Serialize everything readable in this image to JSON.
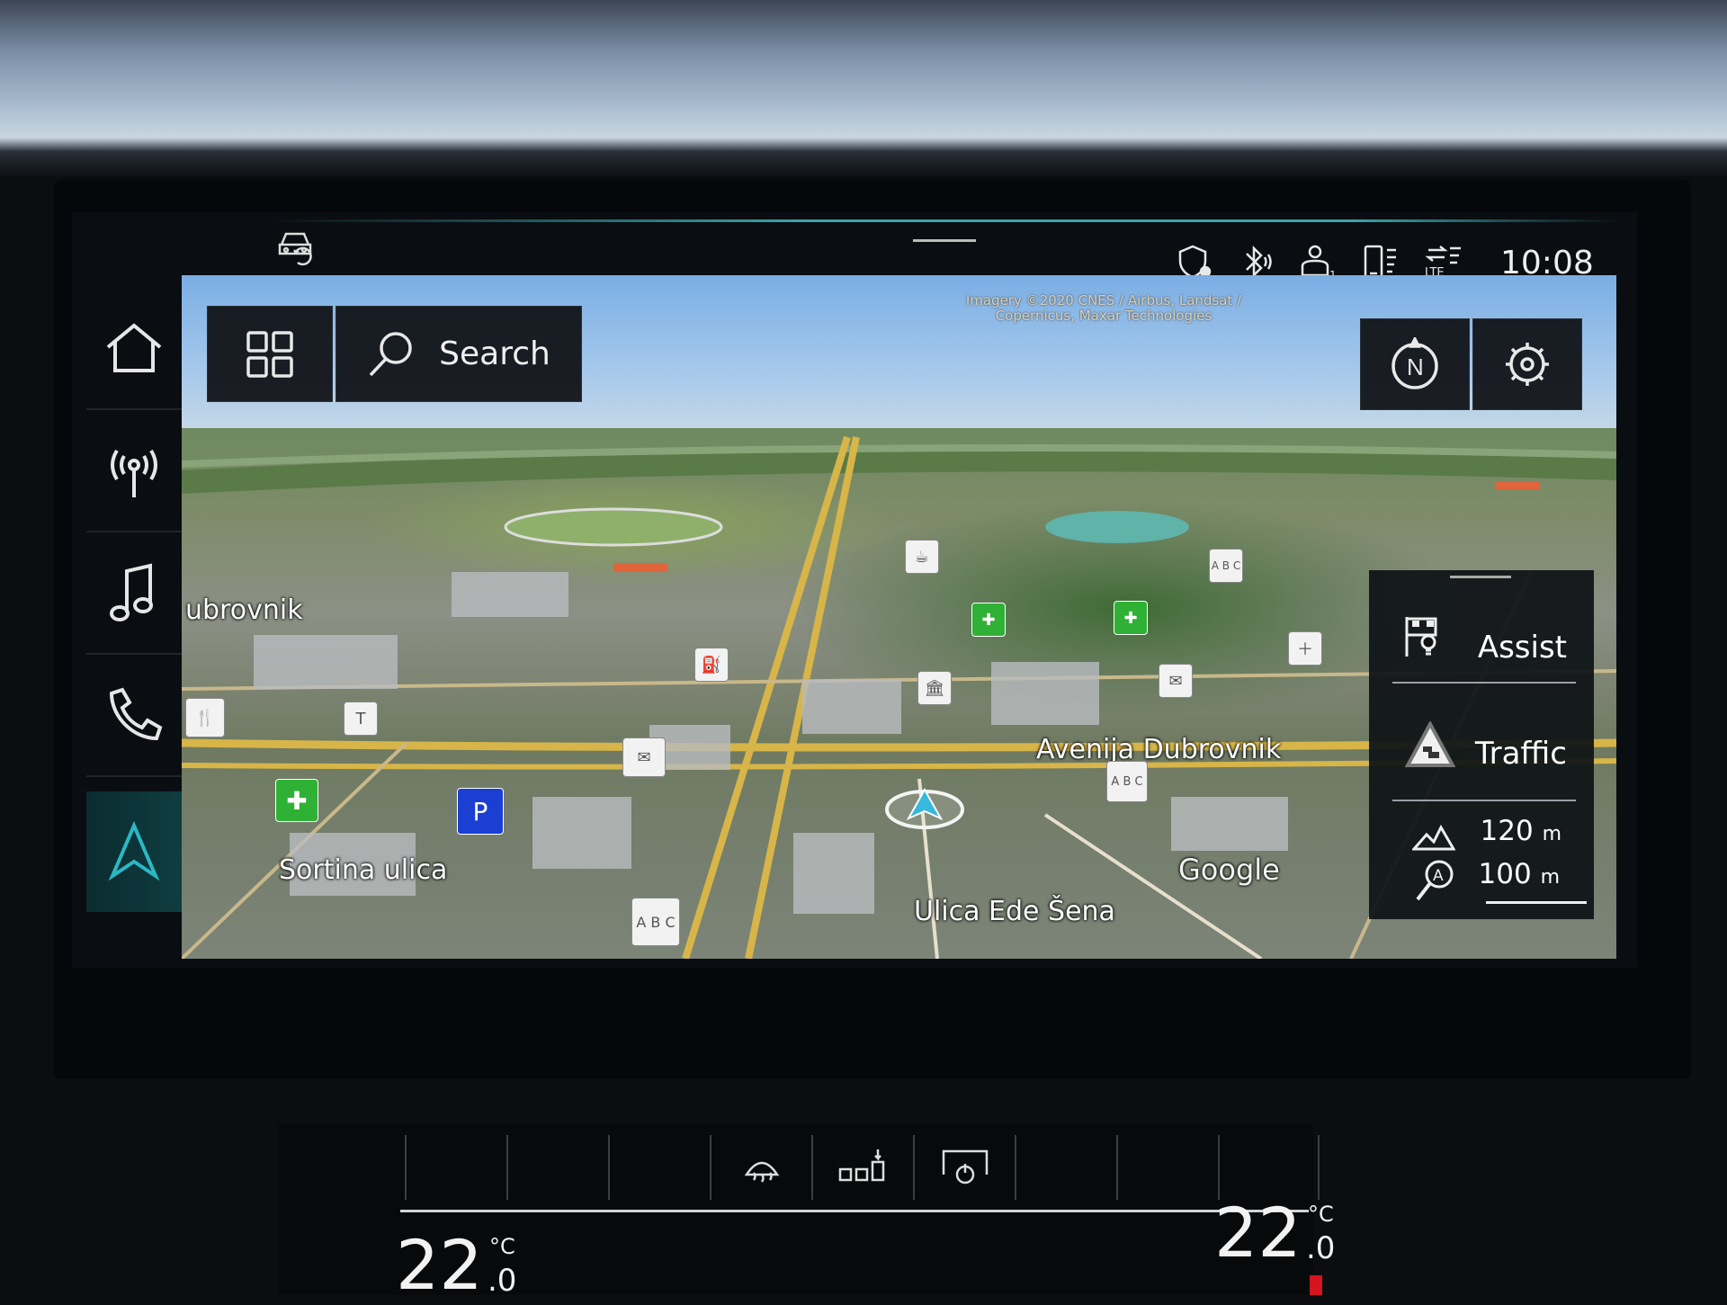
{
  "status_bar": {
    "time": "10:08",
    "icons": [
      "car-sync-icon",
      "privacy-location-icon",
      "bluetooth-audio-icon",
      "user-profile-icon",
      "phone-signal-icon",
      "lte-data-icon"
    ],
    "user_index": "1",
    "network": "LTE"
  },
  "sidebar": {
    "items": [
      {
        "name": "home",
        "icon": "home-icon"
      },
      {
        "name": "radio",
        "icon": "antenna-icon"
      },
      {
        "name": "media",
        "icon": "music-note-icon"
      },
      {
        "name": "phone",
        "icon": "phone-icon"
      },
      {
        "name": "navigation",
        "icon": "navigation-arrow-icon",
        "active": true
      }
    ],
    "accent_color": "#2ab8c4"
  },
  "map": {
    "attribution": [
      "Imagery ©2020 CNES / Airbus, Landsat /",
      "Copernicus, Maxar Technologies"
    ],
    "search_label": "Search",
    "provider": "Google",
    "street_labels": [
      "ubrovnik",
      "Avenija Dubrovnik",
      "Sortina ulica",
      "Ulica Ede Šena"
    ],
    "poi_labels": {
      "parking": "P",
      "ab": "A B C"
    }
  },
  "panel": {
    "assist_label": "Assist",
    "traffic_label": "Traffic",
    "altitude_value": "120",
    "altitude_unit": "m",
    "scale_value": "100",
    "scale_unit": "m",
    "scale_icon_letter": "A"
  },
  "climate": {
    "left_temp": "22",
    "left_decimal": ".0",
    "right_temp": "22",
    "right_decimal": ".0",
    "unit": "°C"
  }
}
